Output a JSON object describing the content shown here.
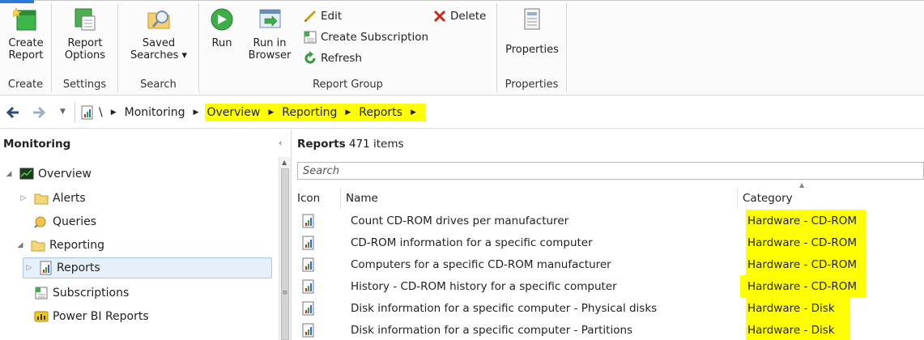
{
  "ribbon": {
    "groups": [
      {
        "label": "Create"
      },
      {
        "label": "Settings"
      },
      {
        "label": "Search"
      },
      {
        "label": "Report Group"
      },
      {
        "label": "Properties"
      }
    ],
    "create_report": "Create\nReport",
    "report_options": "Report\nOptions",
    "saved_searches": "Saved\nSearches ▾",
    "run": "Run",
    "run_in_browser": "Run in\nBrowser",
    "edit": "Edit",
    "create_subscription": "Create Subscription",
    "refresh": "Refresh",
    "delete": "Delete",
    "properties": "Properties"
  },
  "address": {
    "root": "\\",
    "crumbs": [
      {
        "label": "Monitoring",
        "highlight": false
      },
      {
        "label": "Overview",
        "highlight": true
      },
      {
        "label": "Reporting",
        "highlight": true
      },
      {
        "label": "Reports",
        "highlight": true
      }
    ]
  },
  "nav": {
    "title": "Monitoring",
    "items": [
      {
        "label": "Overview"
      },
      {
        "label": "Alerts"
      },
      {
        "label": "Queries"
      },
      {
        "label": "Reporting"
      },
      {
        "label": "Reports"
      },
      {
        "label": "Subscriptions"
      },
      {
        "label": "Power BI Reports"
      }
    ]
  },
  "main": {
    "title": "Reports",
    "count": "471 items",
    "search_placeholder": "Search",
    "columns": {
      "icon": "Icon",
      "name": "Name",
      "category": "Category"
    },
    "rows": [
      {
        "name": "Count CD-ROM drives per manufacturer",
        "category": "Hardware - CD-ROM"
      },
      {
        "name": "CD-ROM information for a specific computer",
        "category": "Hardware - CD-ROM"
      },
      {
        "name": "Computers for a specific CD-ROM manufacturer",
        "category": "Hardware - CD-ROM"
      },
      {
        "name": "History - CD-ROM history for a specific computer",
        "category": "Hardware - CD-ROM"
      },
      {
        "name": "Disk information for a specific computer - Physical disks",
        "category": "Hardware - Disk"
      },
      {
        "name": "Disk information for a specific computer - Partitions",
        "category": "Hardware - Disk"
      }
    ]
  },
  "colors": {
    "highlight": "#ffff00",
    "accent": "#2b78d6"
  }
}
